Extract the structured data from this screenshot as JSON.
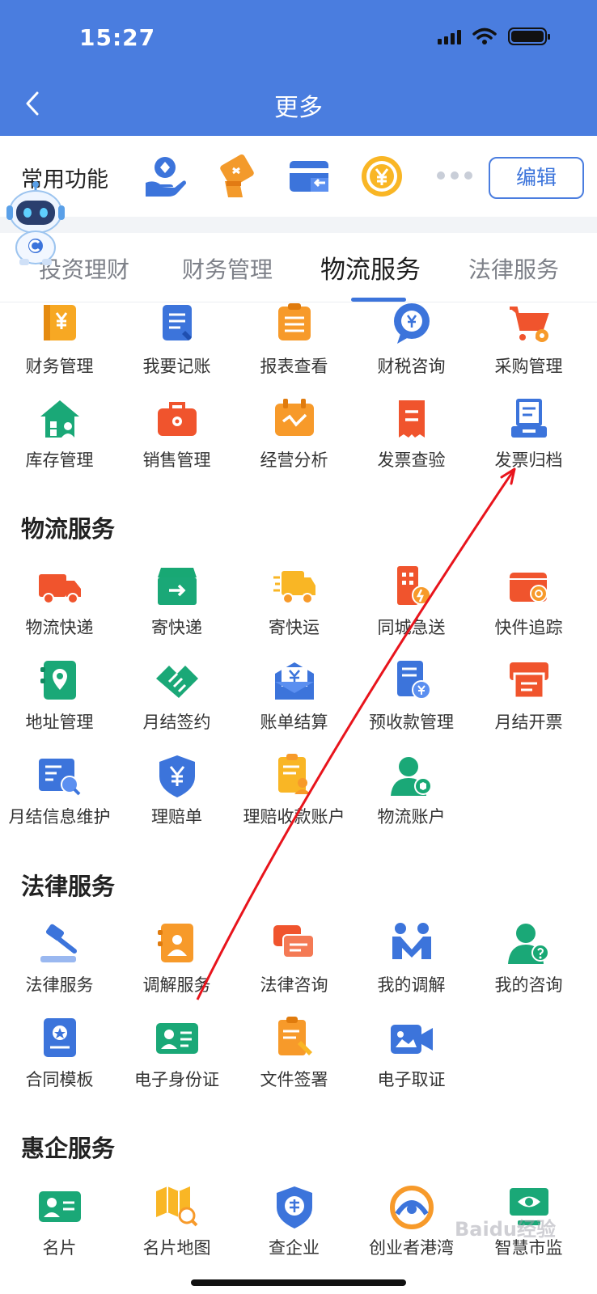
{
  "status": {
    "time": "15:27"
  },
  "nav": {
    "title": "更多"
  },
  "quick": {
    "label": "常用功能",
    "edit_label": "编辑",
    "icons": [
      "hand-person-icon",
      "coupon-icon",
      "card-transfer-icon",
      "yuan-coin-icon"
    ]
  },
  "tabs": [
    {
      "label": "投资理财",
      "active": false
    },
    {
      "label": "财务管理",
      "active": false
    },
    {
      "label": "物流服务",
      "active": true
    },
    {
      "label": "法律服务",
      "active": false
    }
  ],
  "finance_items": [
    {
      "label": "财务管理",
      "icon": "yuan-book-icon"
    },
    {
      "label": "我要记账",
      "icon": "ledger-icon"
    },
    {
      "label": "报表查看",
      "icon": "report-icon"
    },
    {
      "label": "财税咨询",
      "icon": "yuan-chat-icon"
    },
    {
      "label": "采购管理",
      "icon": "cart-icon"
    },
    {
      "label": "库存管理",
      "icon": "warehouse-icon"
    },
    {
      "label": "销售管理",
      "icon": "briefcase-icon"
    },
    {
      "label": "经营分析",
      "icon": "calendar-chart-icon"
    },
    {
      "label": "发票查验",
      "icon": "invoice-check-icon"
    },
    {
      "label": "发票归档",
      "icon": "invoice-archive-icon"
    }
  ],
  "sections": {
    "logistics": {
      "title": "物流服务"
    },
    "legal": {
      "title": "法律服务"
    },
    "benefits": {
      "title": "惠企服务"
    }
  },
  "logistics_items": [
    {
      "label": "物流快递",
      "icon": "truck-icon"
    },
    {
      "label": "寄快递",
      "icon": "parcel-box-icon"
    },
    {
      "label": "寄快运",
      "icon": "fast-truck-icon"
    },
    {
      "label": "同城急送",
      "icon": "city-delivery-icon"
    },
    {
      "label": "快件追踪",
      "icon": "package-track-icon"
    },
    {
      "label": "地址管理",
      "icon": "address-book-icon"
    },
    {
      "label": "月结签约",
      "icon": "handshake-icon"
    },
    {
      "label": "账单结算",
      "icon": "bill-envelope-icon"
    },
    {
      "label": "预收款管理",
      "icon": "prepayment-icon"
    },
    {
      "label": "月结开票",
      "icon": "printer-icon"
    },
    {
      "label": "月结信息维护",
      "icon": "info-maintain-icon"
    },
    {
      "label": "理赔单",
      "icon": "shield-yuan-icon"
    },
    {
      "label": "理赔收款账户",
      "icon": "claim-account-icon"
    },
    {
      "label": "物流账户",
      "icon": "logistics-account-icon"
    }
  ],
  "legal_items": [
    {
      "label": "法律服务",
      "icon": "gavel-icon"
    },
    {
      "label": "调解服务",
      "icon": "mediation-book-icon"
    },
    {
      "label": "法律咨询",
      "icon": "chat-bubbles-icon"
    },
    {
      "label": "我的调解",
      "icon": "people-m-icon"
    },
    {
      "label": "我的咨询",
      "icon": "person-question-icon"
    },
    {
      "label": "合同模板",
      "icon": "contract-icon"
    },
    {
      "label": "电子身份证",
      "icon": "id-card-icon"
    },
    {
      "label": "文件签署",
      "icon": "document-sign-icon"
    },
    {
      "label": "电子取证",
      "icon": "video-camera-icon"
    }
  ],
  "benefit_items": [
    {
      "label": "名片",
      "icon": "business-card-icon"
    },
    {
      "label": "名片地图",
      "icon": "map-search-icon"
    },
    {
      "label": "查企业",
      "icon": "enterprise-shield-icon"
    },
    {
      "label": "创业者港湾",
      "icon": "harbor-logo-icon"
    },
    {
      "label": "智慧市监",
      "icon": "monitor-eye-icon"
    }
  ],
  "watermark": "Baidu经验"
}
